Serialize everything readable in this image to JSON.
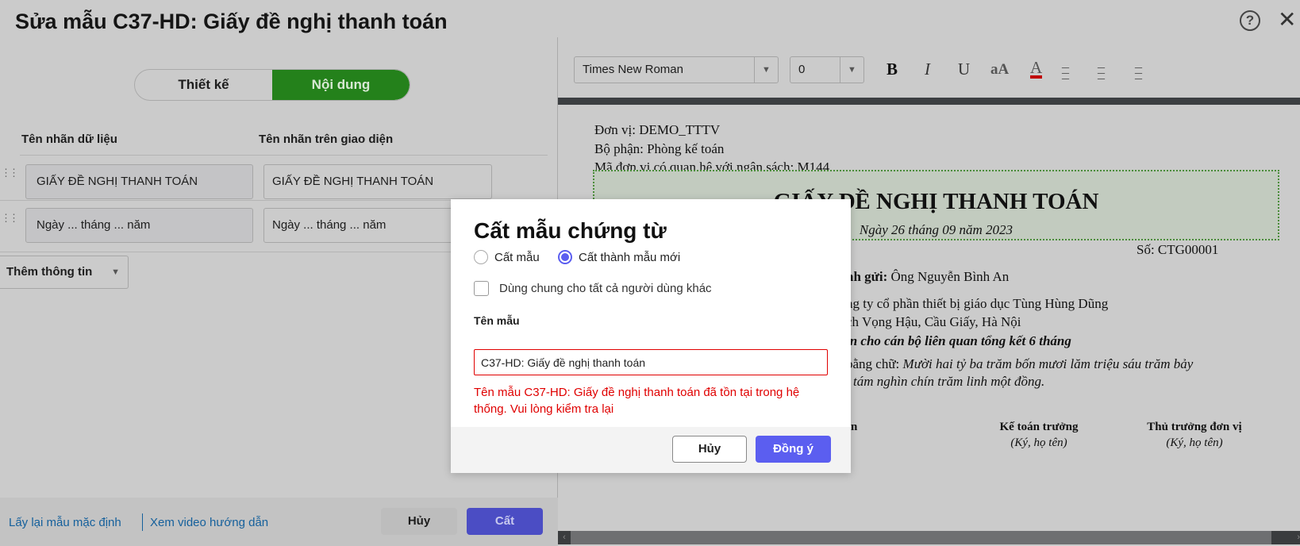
{
  "window": {
    "title": "Sửa mẫu C37-HD: Giấy đề nghị thanh toán",
    "help_icon": "?",
    "close_icon": "✕"
  },
  "left": {
    "tabs": [
      {
        "label": "Thiết kế",
        "active": false
      },
      {
        "label": "Nội dung",
        "active": true
      }
    ],
    "columns": [
      "Tên nhãn dữ liệu",
      "Tên nhãn trên giao diện"
    ],
    "rows": [
      {
        "data_label": "GIẤY ĐỀ NGHỊ THANH TOÁN",
        "ui_label": "GIẤY ĐỀ NGHỊ THANH TOÁN"
      },
      {
        "data_label": "Ngày ... tháng ... năm",
        "ui_label": "Ngày ... tháng ... năm"
      }
    ],
    "add_info": "Thêm thông tin",
    "footer": {
      "reset_link": "Lấy lại mẫu mặc định",
      "video_link": "Xem video hướng dẫn",
      "cancel": "Hủy",
      "save": "Cất"
    }
  },
  "toolbar": {
    "font": "Times New Roman",
    "size": "0",
    "bold": "B",
    "italic": "I",
    "underline": "U",
    "case": "aA",
    "color": "A",
    "text_color": "#c00000"
  },
  "document": {
    "unit": "Đơn vị: DEMO_TTTV",
    "dept": "Bộ phận: Phòng kế toán",
    "budget_code": "Mã đơn vị có quan hệ với ngân sách: M144",
    "heading": "GIẤY ĐỀ NGHỊ THANH TOÁN",
    "date": "Ngày 26 tháng 09 năm 2023",
    "number": "Số: CTG00001",
    "to_label": "nh gửi:",
    "to_value": " Ông Nguyễn Bình An",
    "line_company": "ng ty cổ phần thiết bị giáo dục Tùng Hùng Dũng",
    "line_address": "ch Vọng Hậu, Cầu Giấy, Hà Nội",
    "line_reason": "in cho cán bộ liên quan tổng kết 6 tháng",
    "words_label": " bằng chữ: ",
    "words_value": "Mười hai tỷ ba trăm bốn mươi lăm triệu sáu trăm bảy",
    "words_value2": "i tám nghìn chín trăm linh một đồng.",
    "sig_partial": "n",
    "signers": [
      {
        "title": "Kế toán trưởng",
        "note": "(Ký, họ tên)"
      },
      {
        "title": "Thủ trưởng đơn vị",
        "note": "(Ký, họ tên)"
      }
    ]
  },
  "dialog": {
    "title": "Cất mẫu chứng từ",
    "options": [
      {
        "label": "Cất mẫu",
        "selected": false
      },
      {
        "label": "Cất thành mẫu mới",
        "selected": true
      }
    ],
    "share_label": "Dùng chung cho tất cả người dùng khác",
    "share_checked": false,
    "name_label": "Tên mẫu",
    "name_value": "C37-HD: Giấy đề nghị thanh toán",
    "error": "Tên mẫu C37-HD: Giấy đề nghị thanh toán đã tồn tại trong hệ thống. Vui lòng kiểm tra lại",
    "cancel": "Hủy",
    "ok": "Đồng ý",
    "accent": "#5b5ef0",
    "error_color": "#e00000"
  }
}
